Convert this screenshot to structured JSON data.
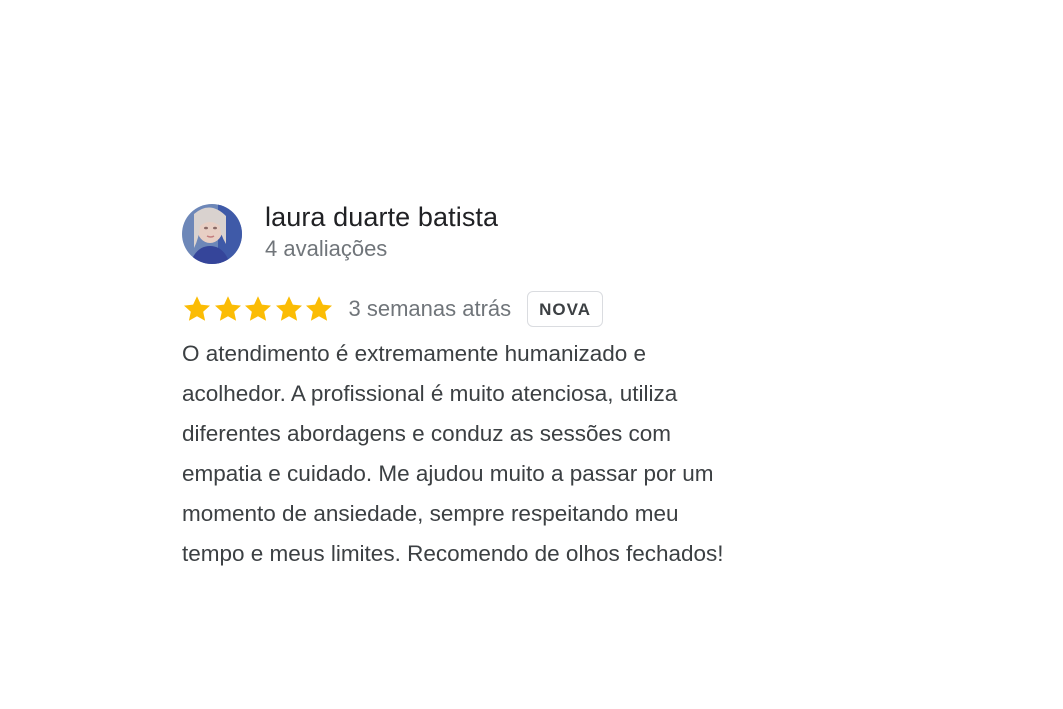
{
  "review": {
    "author_name": "laura duarte batista",
    "author_review_count": "4 avaliações",
    "rating": 5,
    "rating_max": 5,
    "star_color": "#fbbc04",
    "date": "3 semanas atrás",
    "badge": "NOVA",
    "text_lines": [
      "O atendimento é extremamente humanizado e",
      "acolhedor. A profissional é muito atenciosa, utiliza",
      "diferentes abordagens e conduz as sessões com",
      "empatia e cuidado. Me ajudou muito a passar por um",
      "momento de ansiedade, sempre respeitando meu",
      "tempo e meus limites. Recomendo de olhos fechados!"
    ]
  },
  "icons": {
    "avatar": "profile-photo",
    "star": "star-filled-icon"
  }
}
